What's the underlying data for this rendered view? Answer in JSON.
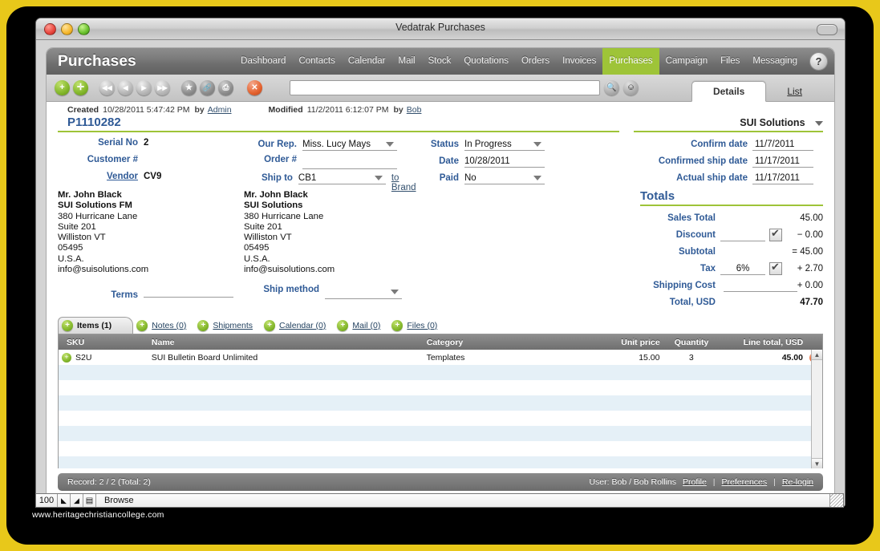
{
  "window": {
    "title": "Vedatrak Purchases"
  },
  "nav": {
    "app_name": "Purchases",
    "items": [
      {
        "label": "Dashboard",
        "active": false
      },
      {
        "label": "Contacts",
        "active": false
      },
      {
        "label": "Calendar",
        "active": false
      },
      {
        "label": "Mail",
        "active": false
      },
      {
        "label": "Stock",
        "active": false
      },
      {
        "label": "Quotations",
        "active": false
      },
      {
        "label": "Orders",
        "active": false
      },
      {
        "label": "Invoices",
        "active": false
      },
      {
        "label": "Purchases",
        "active": true
      },
      {
        "label": "Campaign",
        "active": false
      },
      {
        "label": "Files",
        "active": false
      },
      {
        "label": "Messaging",
        "active": false
      }
    ],
    "help_label": "?",
    "accent_color": "#9ec438"
  },
  "toolbar": {
    "buttons": [
      {
        "name": "new-record-button",
        "glyph": "+"
      },
      {
        "name": "duplicate-record-button",
        "glyph": "✛"
      },
      {
        "name": "first-record-button",
        "glyph": "❘◀"
      },
      {
        "name": "previous-record-button",
        "glyph": "◀"
      },
      {
        "name": "next-record-button",
        "glyph": "▶"
      },
      {
        "name": "last-record-button",
        "glyph": "▶❘"
      },
      {
        "name": "favorite-button",
        "glyph": "★"
      },
      {
        "name": "link-button",
        "glyph": "🔗"
      },
      {
        "name": "print-button",
        "glyph": "⎙"
      },
      {
        "name": "delete-record-button",
        "glyph": "✕"
      }
    ],
    "search_value": "",
    "search_placeholder": "",
    "find_label": "🔍",
    "refresh_label": "↻"
  },
  "view_tabs": [
    {
      "label": "Details",
      "active": true
    },
    {
      "label": "List",
      "active": false
    }
  ],
  "meta": {
    "created_label": "Created",
    "created_value": "10/28/2011 5:47:42 PM",
    "created_by_label": "by",
    "created_by": "Admin",
    "modified_label": "Modified",
    "modified_value": "11/2/2011 6:12:07 PM",
    "modified_by_label": "by",
    "modified_by": "Bob"
  },
  "record": {
    "id": "P1110282",
    "company": "SUI Solutions"
  },
  "form": {
    "col1": [
      {
        "label": "Serial No",
        "value": "2",
        "link": false,
        "bold": true
      },
      {
        "label": "Customer #",
        "value": "",
        "link": false,
        "bold": true
      },
      {
        "label": "Vendor",
        "value": "CV9",
        "link": true,
        "bold": true
      }
    ],
    "col2": [
      {
        "label": "Our Rep.",
        "value": "Miss. Lucy Mays",
        "dropdown": true
      },
      {
        "label": "Order #",
        "value": "",
        "dropdown": false
      },
      {
        "label": "Ship to",
        "value": "CB1",
        "dropdown": true,
        "suffix_link": "to Brand"
      }
    ],
    "col3": [
      {
        "label": "Status",
        "value": "In Progress",
        "dropdown": true
      },
      {
        "label": "Date",
        "value": "10/28/2011",
        "dropdown": false
      },
      {
        "label": "Paid",
        "value": "No",
        "dropdown": true
      }
    ],
    "address_left": [
      {
        "text": "Mr. John Black",
        "bold": true
      },
      {
        "text": "SUI Solutions FM",
        "bold": true
      },
      {
        "text": "380 Hurricane Lane",
        "bold": false
      },
      {
        "text": "Suite 201",
        "bold": false
      },
      {
        "text": "Williston VT",
        "bold": false
      },
      {
        "text": "05495",
        "bold": false
      },
      {
        "text": "U.S.A.",
        "bold": false
      },
      {
        "text": "info@suisolutions.com",
        "bold": false
      }
    ],
    "address_right": [
      {
        "text": "Mr. John Black",
        "bold": true
      },
      {
        "text": "SUI Solutions",
        "bold": true
      },
      {
        "text": "380 Hurricane Lane",
        "bold": false
      },
      {
        "text": "Suite 201",
        "bold": false
      },
      {
        "text": "Williston VT",
        "bold": false
      },
      {
        "text": "05495",
        "bold": false
      },
      {
        "text": "U.S.A.",
        "bold": false
      },
      {
        "text": "info@suisolutions.com",
        "bold": false
      }
    ],
    "terms_label": "Terms",
    "terms_value": "",
    "ship_method_label": "Ship method",
    "ship_method_value": ""
  },
  "dates": [
    {
      "label": "Confirm date",
      "value": "11/7/2011"
    },
    {
      "label": "Confirmed ship date",
      "value": "11/17/2011"
    },
    {
      "label": "Actual ship date",
      "value": "11/17/2011"
    }
  ],
  "totals": {
    "title": "Totals",
    "rows": [
      {
        "label": "Sales Total",
        "field": "",
        "checkbox": false,
        "amount": "45.00",
        "bold": false
      },
      {
        "label": "Discount",
        "field": "",
        "checkbox": true,
        "amount": "− 0.00",
        "bold": false
      },
      {
        "label": "Subtotal",
        "field": "",
        "checkbox": false,
        "amount": "= 45.00",
        "bold": false
      },
      {
        "label": "Tax",
        "field": "6%",
        "checkbox": true,
        "amount": "+ 2.70",
        "bold": false
      },
      {
        "label": "Shipping Cost",
        "field": "",
        "checkbox": false,
        "amount": "+ 0.00",
        "bold": false
      },
      {
        "label": "Total, USD",
        "field": "",
        "checkbox": false,
        "amount": "47.70",
        "bold": true
      }
    ]
  },
  "sub_tabs": [
    {
      "label": "Items (1)",
      "active": true
    },
    {
      "label": "Notes (0)",
      "active": false
    },
    {
      "label": "Shipments",
      "active": false
    },
    {
      "label": "Calendar (0)",
      "active": false
    },
    {
      "label": "Mail (0)",
      "active": false
    },
    {
      "label": "Files (0)",
      "active": false
    }
  ],
  "items_table": {
    "columns": [
      "SKU",
      "Name",
      "Category",
      "Unit price",
      "Quantity",
      "Line total, USD"
    ],
    "rows": [
      {
        "sku": "S2U",
        "name": "SUI Bulletin Board Unlimited",
        "category": "Templates",
        "unit_price": "15.00",
        "quantity": "3",
        "line_total": "45.00"
      }
    ],
    "empty_row_count": 7
  },
  "status": {
    "record_text": "Record: 2 / 2 (Total: 2)",
    "user_text": "User: Bob / Bob Rollins",
    "links": [
      "Profile",
      "Preferences",
      "Re-login"
    ],
    "separator": "|"
  },
  "fm_bar": {
    "zoom": "100",
    "mode": "Browse"
  },
  "watermark": "www.heritagechristiancollege.com"
}
